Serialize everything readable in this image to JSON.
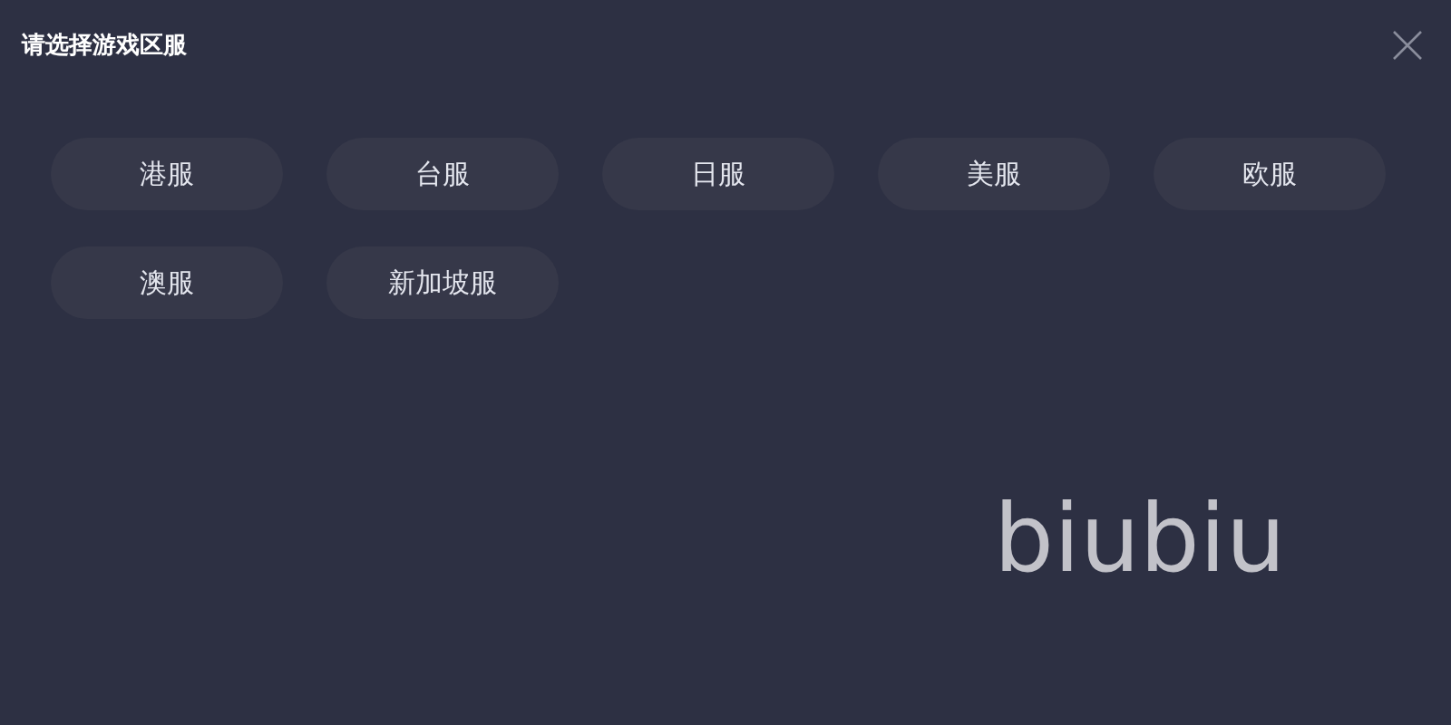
{
  "window": {
    "title": "请选择游戏区服"
  },
  "servers": [
    {
      "label": "港服"
    },
    {
      "label": "台服"
    },
    {
      "label": "日服"
    },
    {
      "label": "美服"
    },
    {
      "label": "欧服"
    },
    {
      "label": "澳服"
    },
    {
      "label": "新加坡服"
    }
  ],
  "logo": {
    "text": "biubiu"
  }
}
